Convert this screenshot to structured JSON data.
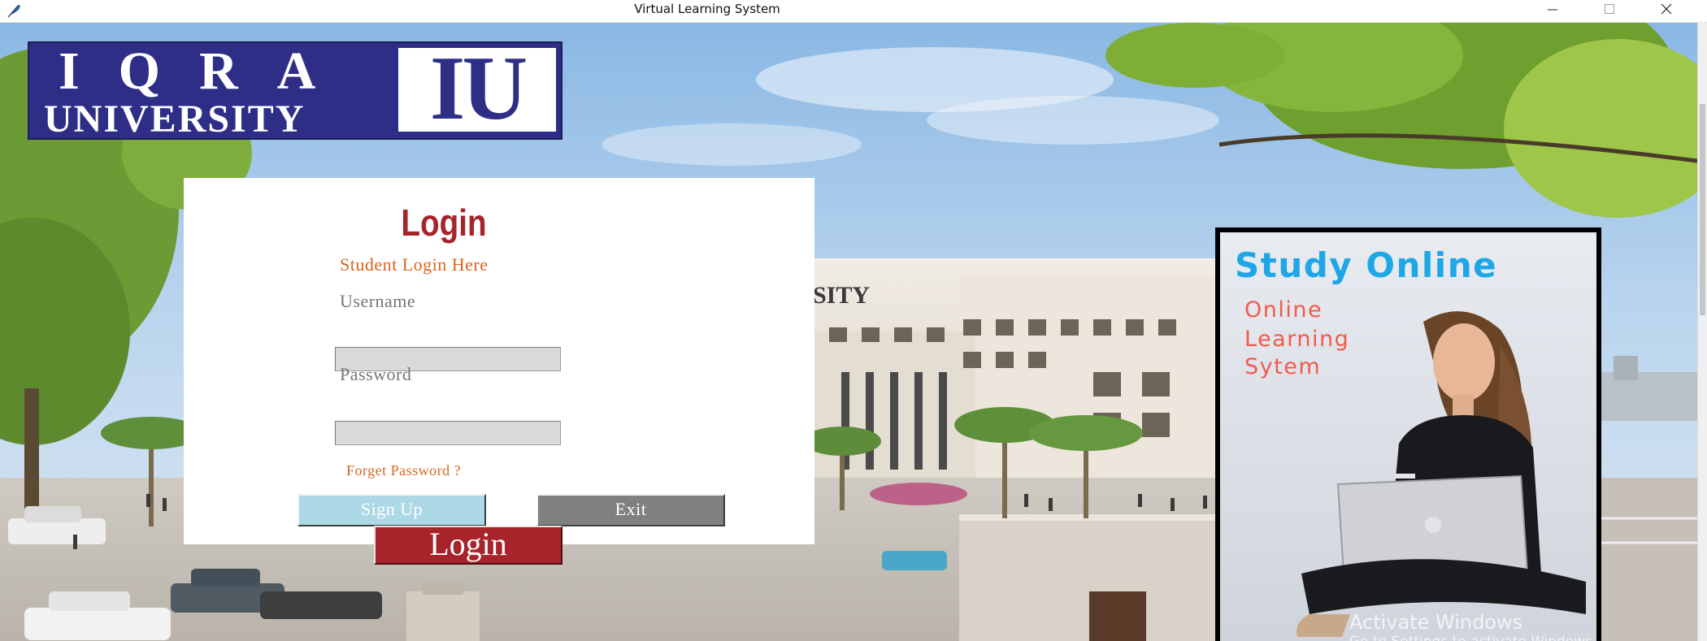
{
  "window": {
    "title": "Virtual Learning System",
    "controls": [
      "minimize",
      "maximize",
      "close"
    ],
    "app_icon": "feather-icon"
  },
  "logo": {
    "line1": "IQRA",
    "line2": "UNIVERSITY",
    "monogram": "IU",
    "colors": {
      "background": "#2e2e86",
      "text": "#ffffff"
    }
  },
  "background": {
    "building_sign": "SITY"
  },
  "login_form": {
    "heading": "Login",
    "subtitle": "Student Login Here",
    "username_label": "Username",
    "username_value": "",
    "password_label": "Password",
    "password_value": "",
    "forget_password": "Forget Password ?",
    "signup_label": "Sign Up",
    "exit_label": "Exit",
    "login_label": "Login",
    "colors": {
      "heading": "#a6242a",
      "accent": "#d9661f",
      "signup": "#add8e6",
      "exit": "#808080",
      "login": "#a6242a"
    }
  },
  "advert": {
    "title": "Study Online",
    "line1": "Online",
    "line2": "Learning",
    "line3": "Sytem",
    "colors": {
      "title": "#1ea7e6",
      "lines": "#f25a4d"
    }
  },
  "watermark": {
    "title": "Activate Windows",
    "subtitle": "Go to Settings to activate Windows."
  }
}
